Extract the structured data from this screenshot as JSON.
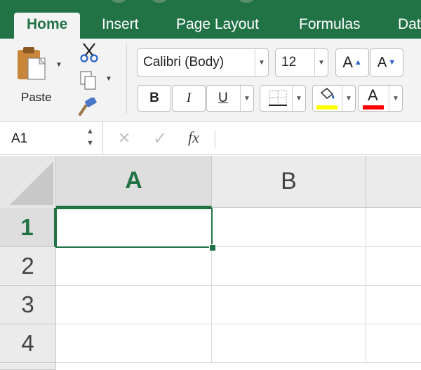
{
  "ribbon": {
    "tabs": [
      {
        "label": "Home",
        "active": true
      },
      {
        "label": "Insert",
        "active": false
      },
      {
        "label": "Page Layout",
        "active": false
      },
      {
        "label": "Formulas",
        "active": false
      },
      {
        "label": "Dat",
        "active": false
      }
    ],
    "clipboard": {
      "paste_label": "Paste"
    },
    "font": {
      "name": "Calibri (Body)",
      "size": "12",
      "bold": "B",
      "italic": "I",
      "underline": "U",
      "grow_label": "A",
      "shrink_label": "A",
      "font_color_letter": "A",
      "fill_color": "#ffff00",
      "font_color": "#ff0000"
    }
  },
  "formula_bar": {
    "name_box": "A1",
    "cancel_symbol": "✕",
    "enter_symbol": "✓",
    "function_label": "fx",
    "content": ""
  },
  "sheet": {
    "columns": [
      "A",
      "B"
    ],
    "rows": [
      "1",
      "2",
      "3",
      "4"
    ],
    "selected_cell": "A1",
    "accent": "#217346"
  }
}
